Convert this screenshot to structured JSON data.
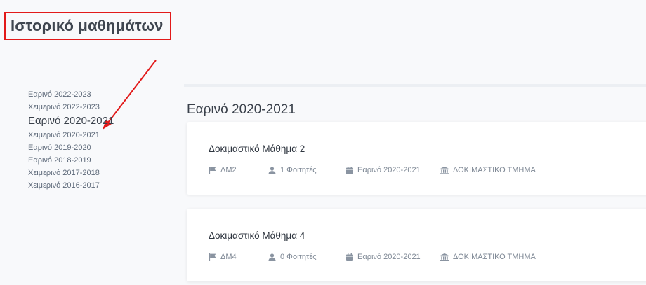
{
  "page": {
    "title": "Ιστορικό μαθημάτων"
  },
  "sidebar": {
    "items": [
      {
        "label": "Εαρινό 2022-2023"
      },
      {
        "label": "Χειμερινό 2022-2023"
      },
      {
        "label": "Εαρινό 2020-2021",
        "active": true
      },
      {
        "label": "Χειμερινό 2020-2021"
      },
      {
        "label": "Εαρινό 2019-2020"
      },
      {
        "label": "Εαρινό 2018-2019"
      },
      {
        "label": "Χειμερινό 2017-2018"
      },
      {
        "label": "Χειμερινό 2016-2017"
      }
    ]
  },
  "main": {
    "semester_heading": "Εαρινό 2020-2021",
    "courses": [
      {
        "title": "Δοκιμαστικό Μάθημα 2",
        "code": "ΔΜ2",
        "students": "1 Φοιτητές",
        "semester": "Εαρινό 2020-2021",
        "department": "ΔΟΚΙΜΑΣΤΙΚΟ ΤΜΗΜΑ"
      },
      {
        "title": "Δοκιμαστικό Μάθημα 4",
        "code": "ΔΜ4",
        "students": "0 Φοιτητές",
        "semester": "Εαρινό 2020-2021",
        "department": "ΔΟΚΙΜΑΣΤΙΚΟ ΤΜΗΜΑ"
      }
    ]
  },
  "icons": {
    "code": "flag-icon",
    "students": "user-icon",
    "semester": "calendar-icon",
    "department": "institution-icon"
  },
  "colors": {
    "highlight": "#e21a1a",
    "icon": "#8a94a1",
    "background": "#f8f9fb"
  }
}
